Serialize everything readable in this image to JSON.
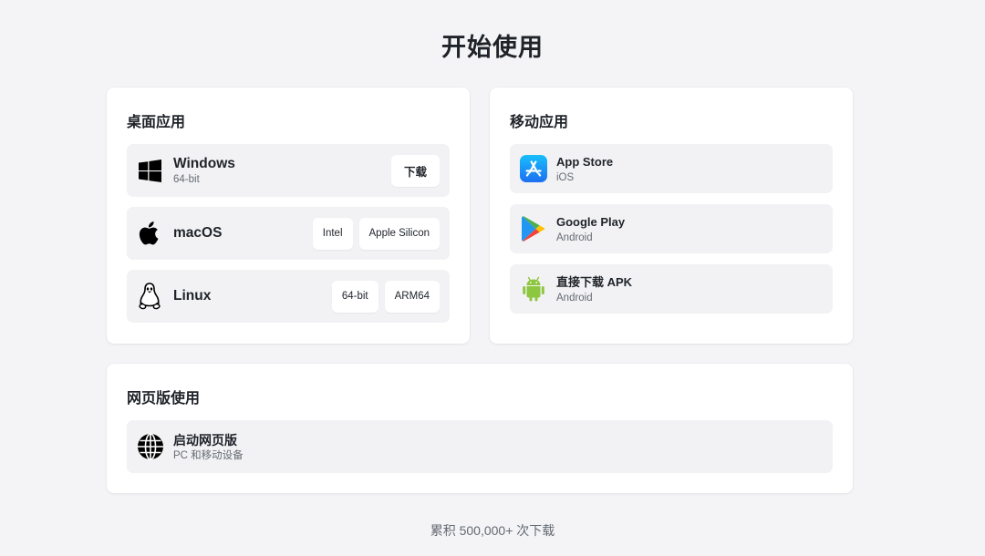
{
  "page": {
    "title": "开始使用",
    "footer": "累积 500,000+ 次下载"
  },
  "desktop": {
    "title": "桌面应用",
    "windows": {
      "name": "Windows",
      "sub": "64-bit",
      "icon": "windows-icon",
      "buttons": [
        "下载"
      ]
    },
    "macos": {
      "name": "macOS",
      "icon": "apple-icon",
      "buttons": [
        "Intel",
        "Apple Silicon"
      ]
    },
    "linux": {
      "name": "Linux",
      "icon": "linux-tux-icon",
      "buttons": [
        "64-bit",
        "ARM64"
      ]
    }
  },
  "mobile": {
    "title": "移动应用",
    "appstore": {
      "name": "App Store",
      "sub": "iOS",
      "icon": "app-store-icon"
    },
    "googleplay": {
      "name": "Google Play",
      "sub": "Android",
      "icon": "google-play-icon"
    },
    "apk": {
      "name": "直接下载 APK",
      "sub": "Android",
      "icon": "android-icon"
    }
  },
  "web": {
    "title": "网页版使用",
    "launch": {
      "name": "启动网页版",
      "sub": "PC 和移动设备",
      "icon": "globe-icon"
    }
  },
  "colors": {
    "background": "#f4f4f6",
    "card": "#ffffff",
    "row": "#f2f2f4",
    "text": "#1f2329",
    "muted": "#666b73",
    "android_green": "#8dc63f",
    "appstore_blue": "#1d8cf8"
  }
}
